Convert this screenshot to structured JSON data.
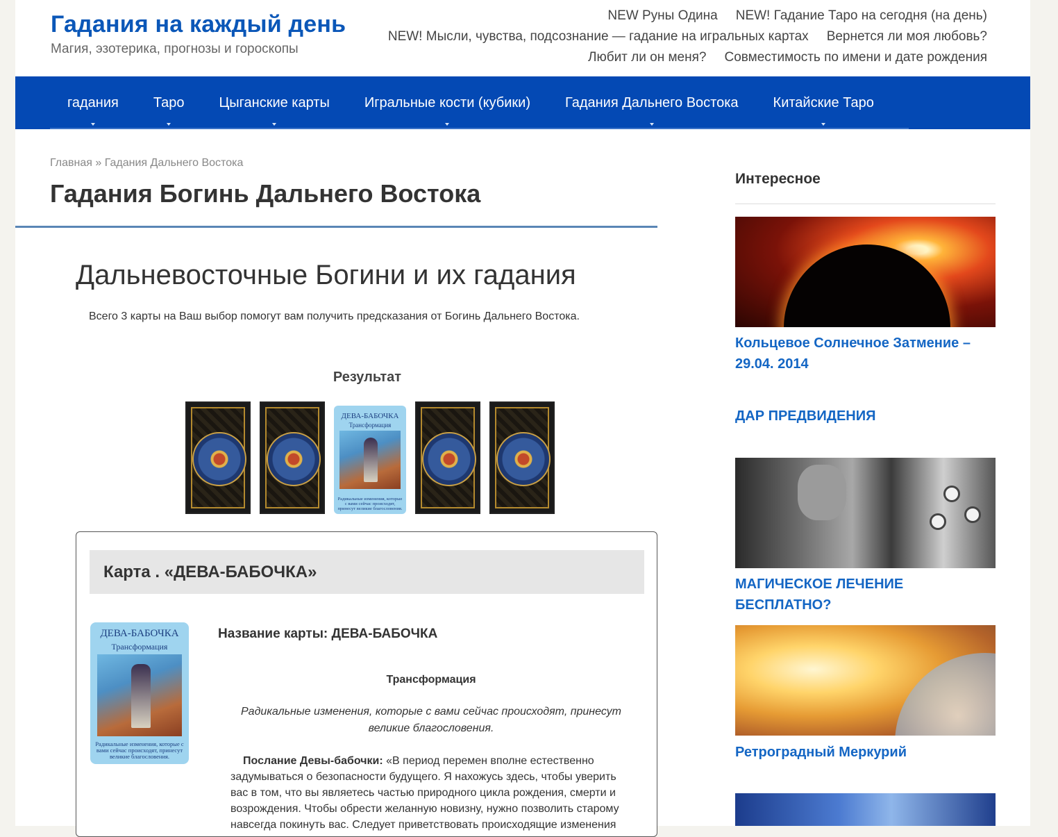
{
  "site": {
    "title": "Гадания на каждый день",
    "tagline": "Магия, эзотерика, прогнозы и гороскопы"
  },
  "top_links": [
    [
      "NEW Руны Одина",
      "NEW! Гадание Таро на сегодня (на день)"
    ],
    [
      "NEW! Мысли, чувства, подсознание — гадание на игральных картах",
      "Вернется ли моя любовь?"
    ],
    [
      "Любит ли он меня?",
      "Совместимость по имени и дате рождения"
    ]
  ],
  "nav": {
    "items": [
      "гадания",
      "Таро",
      "Цыганские карты",
      "Игральные кости (кубики)",
      "Гадания Дальнего Востока",
      "Китайские Таро"
    ]
  },
  "breadcrumb": {
    "home": "Главная",
    "separator": "»",
    "current": "Гадания Дальнего Востока"
  },
  "page_title": "Гадания Богинь Дальнего Востока",
  "content": {
    "heading": "Дальневосточные Богини и их гадания",
    "intro": "Всего 3 карты на Ваш выбор помогут вам получить предсказания от Богинь Дальнего Востока.",
    "result_label": "Результат"
  },
  "card": {
    "front_title": "ДЕВА-БАБОЧКА",
    "front_subtitle": "Трансформация",
    "front_caption": "Радикальные изменения, которые с вами сейчас происходят, принесут великие благословения.",
    "header": "Карта . «ДЕВА-БАБОЧКА»",
    "name_line": "Название карты: ДЕВА-БАБОЧКА",
    "subtitle": "Трансформация",
    "summary": "Радикальные изменения, которые с вами сейчас происходят, принесут великие благословения.",
    "message_label": "Послание Девы-бабочки:",
    "message_text": " «В период перемен вполне естественно задумываться о безопасности будущего. Я нахожусь здесь, чтобы уверить вас в том, что вы являетесь частью природного цикла рождения, смерти и возрождения. Чтобы обрести желанную новизну, нужно позволить старому навсегда покинуть вас. Следует приветствовать происходящие изменения"
  },
  "sidebar": {
    "heading": "Интересное",
    "links": [
      "Кольцевое Солнечное Затмение – 29.04. 2014",
      "ДАР ПРЕДВИДЕНИЯ",
      "МАГИЧЕСКОЕ ЛЕЧЕНИЕ БЕСПЛАТНО?",
      "Ретроградный Меркурий"
    ]
  },
  "colors": {
    "brand": "#0b57b8",
    "nav_bg": "#0449b4",
    "link": "#1466c4",
    "card_bg": "#9fd4ef"
  },
  "icons": [
    "nav-caret-icon"
  ]
}
